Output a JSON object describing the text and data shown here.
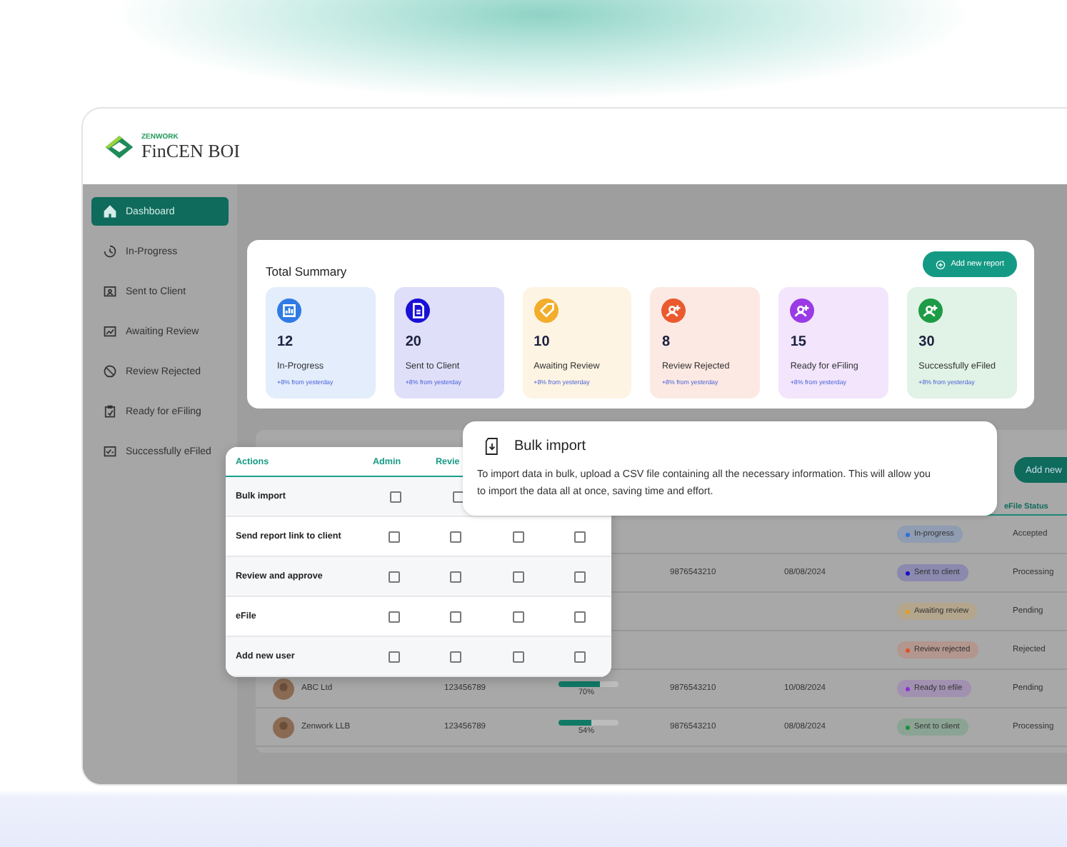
{
  "logo": {
    "brand": "ZENWORK",
    "product": "FinCEN BOI"
  },
  "sidebar": {
    "items": [
      {
        "label": "Dashboard",
        "selected": true
      },
      {
        "label": "In-Progress",
        "selected": false
      },
      {
        "label": "Sent to Client",
        "selected": false
      },
      {
        "label": "Awaiting Review",
        "selected": false
      },
      {
        "label": "Review Rejected",
        "selected": false
      },
      {
        "label": "Ready for eFiling",
        "selected": false
      },
      {
        "label": "Successfully eFiled",
        "selected": false
      }
    ]
  },
  "summary": {
    "title": "Total Summary",
    "add_button": "Add new report",
    "cards": [
      {
        "count": "12",
        "label": "In-Progress",
        "trend": "+8% from yesterday",
        "color": "#2f7ae5"
      },
      {
        "count": "20",
        "label": "Sent to Client",
        "trend": "+8% from yesterday",
        "color": "#1a11d6"
      },
      {
        "count": "10",
        "label": "Awaiting Review",
        "trend": "+8% from yesterday",
        "color": "#f2ad2c"
      },
      {
        "count": "8",
        "label": "Review Rejected",
        "trend": "+8% from yesterday",
        "color": "#ea5a2e"
      },
      {
        "count": "15",
        "label": "Ready for eFiling",
        "trend": "+8% from yesterday",
        "color": "#9a3ae6"
      },
      {
        "count": "30",
        "label": "Successfully eFiled",
        "trend": "+8% from yesterday",
        "color": "#1e9b46"
      }
    ]
  },
  "reports": {
    "add_button": "Add new",
    "status_header": "eFile Status",
    "rows": [
      {
        "status": "In-progress",
        "color": "#2f6fd8",
        "efile": "Accepted"
      },
      {
        "phone": "9876543210",
        "date": "08/08/2024",
        "status": "Sent to client",
        "color": "#1a11c6",
        "efile": "Processing"
      },
      {
        "status": "Awaiting review",
        "color": "#e0a020",
        "efile": "Pending"
      },
      {
        "status": "Review rejected",
        "color": "#e0502a",
        "efile": "Rejected"
      },
      {
        "name": "ABC Ltd",
        "id": "123456789",
        "level": 0.7,
        "percent": "70%",
        "phone": "9876543210",
        "date": "10/08/2024",
        "status": "Ready to efile",
        "color": "#8a30d8",
        "efile": "Pending"
      },
      {
        "name": "Zenwork LLB",
        "id": "123456789",
        "level": 0.54,
        "percent": "54%",
        "phone": "9876543210",
        "date": "08/08/2024",
        "status": "Sent to client",
        "color": "#1a9040",
        "efile": "Processing"
      }
    ]
  },
  "permissions": {
    "columns": [
      "Actions",
      "Admin",
      "Revie"
    ],
    "rows": [
      {
        "action": "Bulk import",
        "checks": [
          false,
          false
        ]
      },
      {
        "action": "Send report link to client",
        "checks": [
          false,
          false,
          false,
          false
        ]
      },
      {
        "action": "Review and approve",
        "checks": [
          false,
          false,
          false,
          false
        ]
      },
      {
        "action": "eFile",
        "checks": [
          false,
          false,
          false,
          false
        ]
      },
      {
        "action": "Add new user",
        "checks": [
          false,
          false,
          false,
          false
        ]
      }
    ]
  },
  "tooltip": {
    "title": "Bulk import",
    "text": "To import data in bulk, upload a CSV file containing all the necessary information. This will allow you to import the data all at once, saving time and effort."
  }
}
